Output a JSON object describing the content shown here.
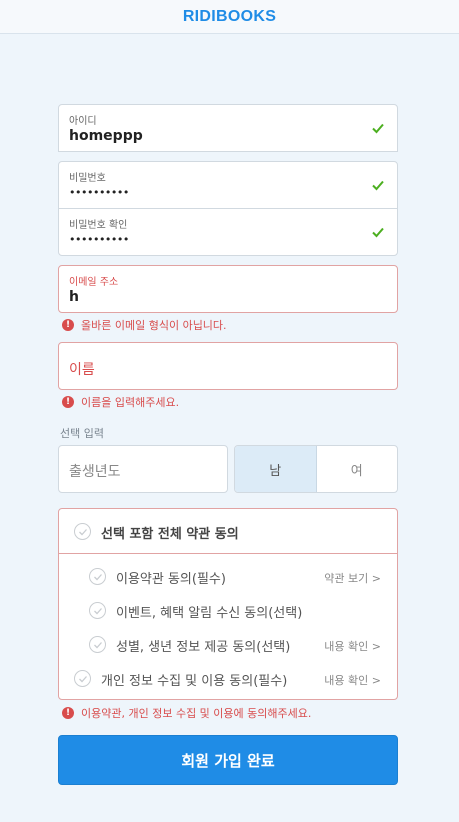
{
  "header": {
    "logo": "RIDIBOOKS"
  },
  "form": {
    "id": {
      "label": "아이디",
      "value": "homeppp"
    },
    "password": {
      "label": "비밀번호",
      "value": "••••••••••"
    },
    "password_confirm": {
      "label": "비밀번호 확인",
      "value": "••••••••••"
    },
    "email": {
      "label": "이메일 주소",
      "value": "h",
      "error": "올바른 이메일 형식이 아닙니다."
    },
    "name": {
      "placeholder": "이름",
      "error": "이름을 입력해주세요."
    },
    "optional_label": "선택 입력",
    "birth_year": {
      "placeholder": "출생년도"
    },
    "gender": {
      "options": [
        "남",
        "여"
      ],
      "selected": "남"
    }
  },
  "agreements": {
    "all": "선택 포함 전체 약관 동의",
    "items": [
      {
        "label": "이용약관 동의(필수)",
        "link": "약관 보기 >"
      },
      {
        "label": "이벤트, 혜택 알림 수신 동의(선택)",
        "link": ""
      },
      {
        "label": "성별, 생년 정보 제공 동의(선택)",
        "link": "내용 확인 >"
      },
      {
        "label": "개인 정보 수집 및 이용 동의(필수)",
        "link": "내용 확인 >"
      }
    ],
    "error": "이용약관, 개인 정보 수집 및 이용에 동의해주세요."
  },
  "submit_label": "회원 가입 완료",
  "colors": {
    "brand": "#1f8ce6",
    "error": "#d84c4c",
    "valid": "#4caf20"
  },
  "icons": {
    "valid": "checkmark-icon",
    "error": "exclamation-icon",
    "agree": "check-circle-icon"
  }
}
